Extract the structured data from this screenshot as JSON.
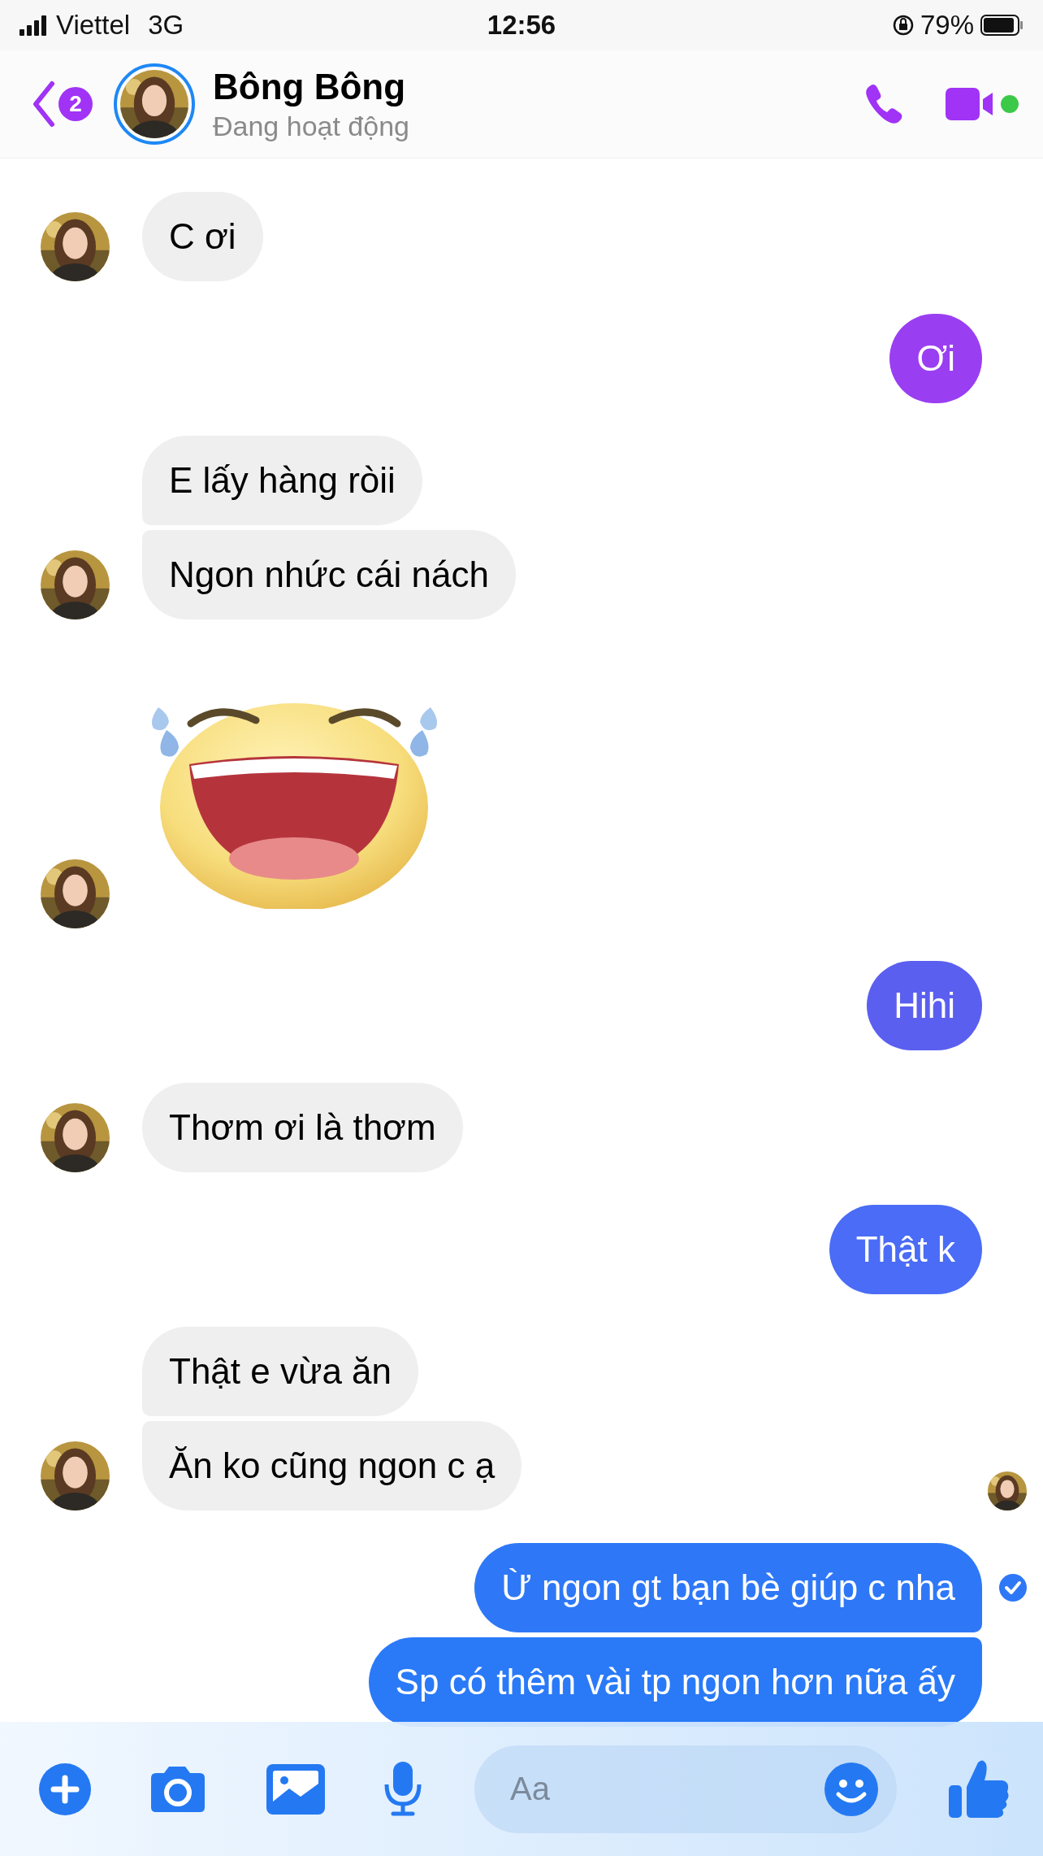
{
  "status_bar": {
    "carrier": "Viettel",
    "network": "3G",
    "time": "12:56",
    "battery": "79%"
  },
  "header": {
    "unread_count": "2",
    "name": "Bông Bông",
    "status": "Đang hoạt động",
    "online": true
  },
  "messages": [
    {
      "kind": "received",
      "items": [
        {
          "kind": "text",
          "text": "C ơi"
        }
      ]
    },
    {
      "kind": "sent",
      "items": [
        {
          "kind": "text",
          "text": "Ơi",
          "color": "#9a3ef2"
        }
      ]
    },
    {
      "kind": "received",
      "items": [
        {
          "kind": "text",
          "text": "E lấy hàng ròii"
        },
        {
          "kind": "text",
          "text": "Ngon nhức cái nách"
        }
      ]
    },
    {
      "kind": "received",
      "items": [
        {
          "kind": "sticker"
        }
      ]
    },
    {
      "kind": "sent",
      "items": [
        {
          "kind": "text",
          "text": "Hihi",
          "color": "#5b5ff0"
        }
      ]
    },
    {
      "kind": "received",
      "items": [
        {
          "kind": "text",
          "text": "Thơm ơi là thơm"
        }
      ]
    },
    {
      "kind": "sent",
      "items": [
        {
          "kind": "text",
          "text": "Thật k",
          "color": "#4a6cf6"
        }
      ]
    },
    {
      "kind": "received",
      "items": [
        {
          "kind": "text",
          "text": "Thật e vừa ăn"
        },
        {
          "kind": "text",
          "text": "Ăn ko cũng ngon c ạ",
          "seen": true
        }
      ]
    },
    {
      "kind": "sent",
      "items": [
        {
          "kind": "text",
          "text": "Ừ ngon gt bạn bè giúp c nha",
          "color": "#2e78f7",
          "delivered": true
        },
        {
          "kind": "text",
          "text": "Sp có thêm vài tp ngon hơn nữa ấy",
          "color": "#2a7af8"
        }
      ]
    }
  ],
  "composer": {
    "placeholder": "Aa"
  }
}
